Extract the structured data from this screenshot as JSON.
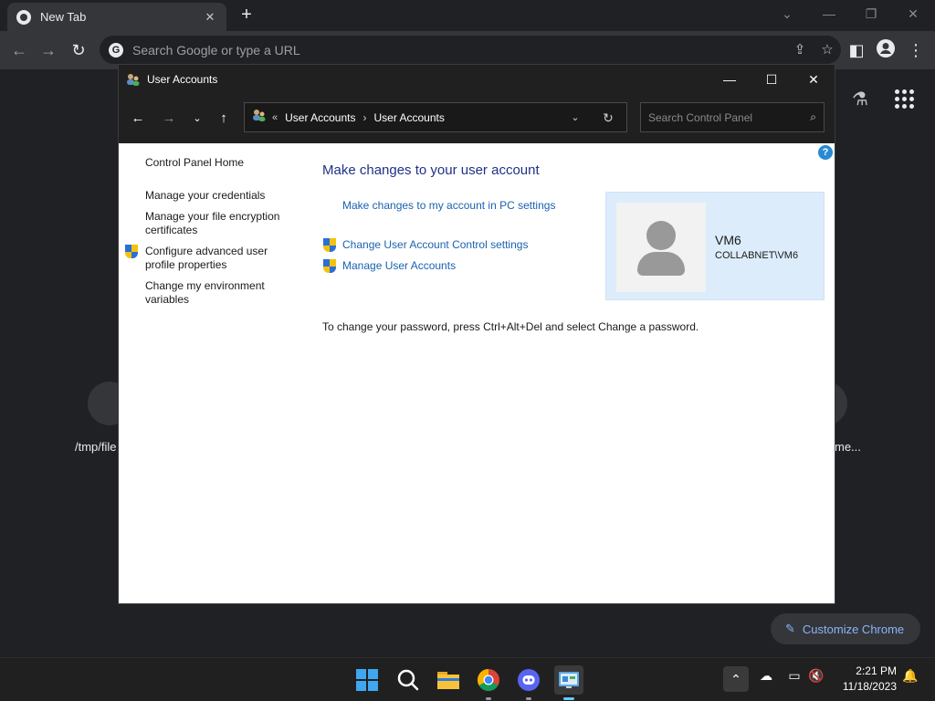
{
  "chrome": {
    "tab_title": "New Tab",
    "tab_close": "✕",
    "new_tab": "+",
    "omnibox_placeholder": "Search Google or type a URL",
    "g_letter": "G"
  },
  "ntp": {
    "shortcut_left_label": "/tmp/file",
    "shortcut_right_label": "me...",
    "customize_label": "Customize Chrome"
  },
  "window": {
    "title": "User Accounts",
    "breadcrumb": [
      "User Accounts",
      "User Accounts"
    ],
    "search_placeholder": "Search Control Panel",
    "help": "?"
  },
  "sidebar": {
    "items": [
      {
        "label": "Control Panel Home",
        "shield": false
      },
      {
        "label": "Manage your credentials",
        "shield": false
      },
      {
        "label": "Manage your file encryption certificates",
        "shield": false
      },
      {
        "label": "Configure advanced user profile properties",
        "shield": true
      },
      {
        "label": "Change my environment variables",
        "shield": false
      }
    ]
  },
  "main": {
    "heading": "Make changes to your user account",
    "link_pc_settings": "Make changes to my account in PC settings",
    "link_uac": "Change User Account Control settings",
    "link_manage": "Manage User Accounts",
    "password_note": "To change your password, press Ctrl+Alt+Del and select Change a password."
  },
  "user": {
    "name": "VM6",
    "domain": "COLLABNET\\VM6"
  },
  "taskbar": {
    "apps": [
      "start-icon",
      "search-icon",
      "file-explorer-icon",
      "chrome-icon",
      "discord-icon",
      "control-panel-icon"
    ],
    "time": "2:21 PM",
    "date": "11/18/2023"
  },
  "colors": {
    "accent": "#60cdff",
    "link": "#1a62b0",
    "heading": "#1e3287",
    "card": "#dcecfb"
  }
}
